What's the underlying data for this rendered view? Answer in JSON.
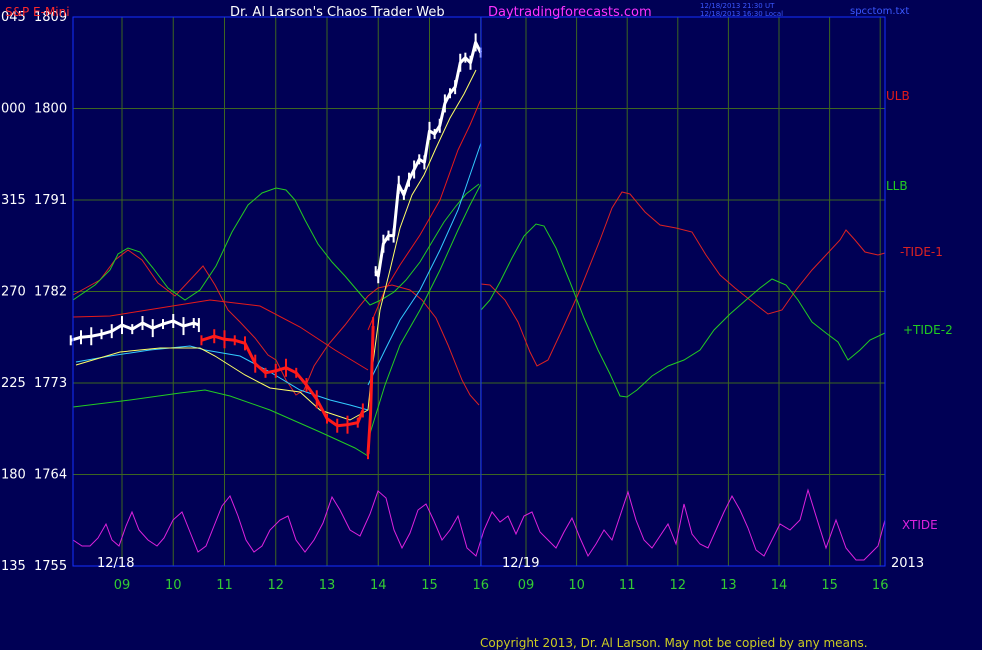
{
  "header": {
    "instrument": "S&P E-Mini",
    "author": "Dr. Al Larson's Chaos Trader Web",
    "website": "Daytradingforecasts.com",
    "timestamp_line1": "12/18/2013 21:30 UT",
    "timestamp_line2": "12/18/2013 16:30 Local",
    "filename": "spcctom.txt"
  },
  "footer": {
    "copyright": "Copyright 2013, Dr. Al Larson. May not be copied by any means."
  },
  "colors": {
    "background": "#000055",
    "frame": "#1530ff",
    "grid": "#3d6620",
    "price_up": "#ffffff",
    "price_down": "#ff1a1a",
    "ma_yellow": "#ffff66",
    "ma_cyan": "#33ccff",
    "ulb": "#e61a1a",
    "llb": "#22cc22",
    "tide_minus": "#dd2222",
    "tide_plus": "#22cc22",
    "xtide": "#dd22dd",
    "axis_text_left": "#ffffff",
    "axis_text_bottom": "#33cc33"
  },
  "chart_data": {
    "type": "line",
    "title": "S&P E-Mini",
    "y_tick_labels": [
      {
        "left": "045",
        "right": "1809",
        "value": 1809
      },
      {
        "left": "000",
        "right": "1800",
        "value": 1800
      },
      {
        "left": "315",
        "right": "1791",
        "value": 1791
      },
      {
        "left": "270",
        "right": "1782",
        "value": 1782
      },
      {
        "left": "225",
        "right": "1773",
        "value": 1773
      },
      {
        "left": "180",
        "right": "1764",
        "value": 1764
      },
      {
        "left": "135",
        "right": "1755",
        "value": 1755
      }
    ],
    "ylim": [
      1755,
      1809
    ],
    "x_tick_labels": [
      "09",
      "10",
      "11",
      "12",
      "13",
      "14",
      "15",
      "16",
      "09",
      "10",
      "11",
      "12",
      "13",
      "14",
      "15",
      "16"
    ],
    "date_labels": [
      "12/18",
      "12/19"
    ],
    "year_label": "2013",
    "legend": [
      "ULB",
      "LLB",
      "-TIDE-1",
      "+TIDE-2",
      "XTIDE"
    ],
    "legend_placement": "right",
    "grid": true,
    "price_segments": [
      {
        "color": "up",
        "hours": [
          8.0,
          8.2,
          8.4,
          8.6,
          8.8,
          9.0,
          9.2,
          9.4,
          9.6,
          9.8,
          10.0,
          10.2,
          10.4,
          10.5
        ],
        "close": [
          1777.2,
          1777.5,
          1777.6,
          1777.8,
          1778.1,
          1778.7,
          1778.3,
          1778.9,
          1778.4,
          1778.8,
          1779.1,
          1778.6,
          1778.9,
          1778.7
        ]
      },
      {
        "color": "down",
        "hours": [
          10.55,
          10.8,
          11.0,
          11.2,
          11.4,
          11.6,
          11.8,
          12.0,
          12.2,
          12.4,
          12.6,
          12.8,
          13.0,
          13.2,
          13.4,
          13.6,
          13.7
        ],
        "close": [
          1777.2,
          1777.6,
          1777.3,
          1777.2,
          1776.9,
          1774.9,
          1774.0,
          1774.2,
          1774.5,
          1774.0,
          1772.8,
          1771.4,
          1769.5,
          1768.8,
          1768.9,
          1769.1,
          1770.3
        ]
      },
      {
        "color": "down",
        "hours": [
          13.8,
          13.85,
          13.9
        ],
        "close": [
          1766.0,
          1770.0,
          1778.6
        ]
      },
      {
        "color": "up",
        "hours": [
          13.95,
          14.0,
          14.1,
          14.2,
          14.3,
          14.4,
          14.5,
          14.6,
          14.7,
          14.8,
          14.9,
          15.0,
          15.1,
          15.2,
          15.3,
          15.4,
          15.5,
          15.6,
          15.7,
          15.8,
          15.9,
          16.0
        ],
        "close": [
          1784.0,
          1783.5,
          1786.7,
          1787.5,
          1787.5,
          1792.5,
          1791.5,
          1793.0,
          1794.0,
          1795.0,
          1794.7,
          1797.8,
          1797.5,
          1798.3,
          1800.5,
          1801.5,
          1802.1,
          1804.5,
          1805.0,
          1804.5,
          1806.5,
          1805.5
        ]
      }
    ],
    "series": [
      {
        "name": "ULB",
        "hours": [
          14.0,
          16.0
        ],
        "values": [
          1773.6,
          1801.0
        ]
      },
      {
        "name": "LLB",
        "hours": [
          14.0,
          16.0
        ],
        "values": [
          1767.7,
          1791.5
        ]
      }
    ]
  }
}
